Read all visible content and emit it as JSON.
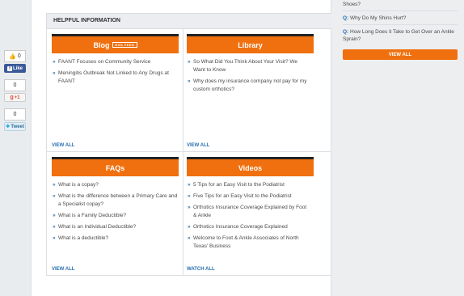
{
  "social": {
    "like_count": "0",
    "like_label": "Like",
    "share_count": "0",
    "gplus_label": "+1",
    "gplus_count": "0",
    "tweet_label": "Tweet"
  },
  "helpful": {
    "title": "HELPFUL INFORMATION"
  },
  "blog": {
    "title": "Blog",
    "rss_label": "RSS FEED",
    "items": [
      "FAANT Focuses on Community Service",
      "Meningitis Outbreak Not Linked to Any Drugs at FAANT"
    ],
    "view_all": "VIEW ALL"
  },
  "library": {
    "title": "Library",
    "items": [
      "So What Did You Think About Your Visit? We Want to Know",
      "Why does my insurance company not pay for my custom orthotics?"
    ],
    "view_all": "VIEW ALL"
  },
  "faqs": {
    "title": "FAQs",
    "items": [
      "What is a copay?",
      "What is the difference between a Primary Care and a Specialist copay?",
      "What is a Family Deductible?",
      "What is an Individual Deductible?",
      "What is a deductible?"
    ],
    "view_all": "VIEW ALL"
  },
  "videos": {
    "title": "Videos",
    "items": [
      "5 Tips for an Easy Visit to the Podiatrist",
      "Five Tips for an Easy Visit to the Podiatrist",
      "Orthotics Insurance Coverage Explained by Foot & Ankle",
      "Orthotics Insurance Coverage Explained",
      "Welcome to Foot & Ankle Associates of North Texas' Business"
    ],
    "view_all": "WATCH ALL"
  },
  "sidebar": {
    "q_prefix": "Q:",
    "questions": [
      "Shoes?",
      "Why Do My Shins Hurt?",
      "How Long Does it Take to Get Over an Ankle Sprain?"
    ],
    "view_all": "VIEW ALL"
  },
  "colors": {
    "accent": "#f0700f",
    "link": "#2a6fb0",
    "facebook": "#3b5998"
  }
}
